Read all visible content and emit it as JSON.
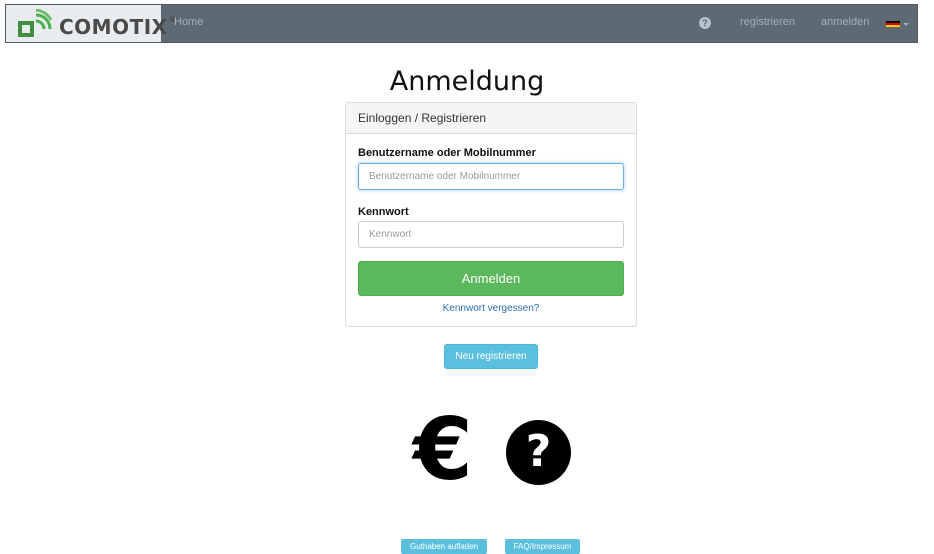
{
  "navbar": {
    "brand": "COMOTIX",
    "brand_reg": "®",
    "home": "Home",
    "help_icon": "question-circle-icon",
    "register": "registrieren",
    "login": "anmelden",
    "language_flag": "german-flag-icon"
  },
  "page": {
    "title": "Anmeldung"
  },
  "login_panel": {
    "heading": "Einloggen / Registrieren",
    "username_label": "Benutzername oder Mobilnummer",
    "username_placeholder": "Benutzername oder Mobilnummer",
    "password_label": "Kennwort",
    "password_placeholder": "Kennwort",
    "submit_label": "Anmelden",
    "forgot_link": "Kennwort vergessen?"
  },
  "register_button": "Neu registrieren",
  "icons": {
    "euro": "€",
    "help": "?"
  },
  "footer": {
    "topup": "Guthaben aufladen",
    "faq": "FAQ/Impressum"
  },
  "colors": {
    "navbar_bg": "#5d6a73",
    "success": "#5cb85c",
    "info": "#5bc0de",
    "link": "#2a6fb0"
  }
}
